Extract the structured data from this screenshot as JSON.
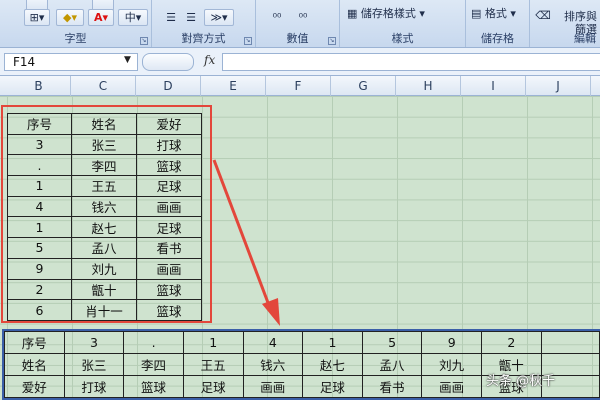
{
  "ribbon": {
    "groups": {
      "font": {
        "label": "字型"
      },
      "alignment": {
        "label": "對齊方式"
      },
      "number": {
        "label": "數值"
      },
      "styles": {
        "label": "樣式",
        "cell_styles_label": "儲存格樣式"
      },
      "cells": {
        "label": "儲存格",
        "format_label": "格式"
      },
      "editing": {
        "label": "編輯",
        "sort_filter_label": "排序與\n篩選"
      }
    }
  },
  "formula_bar": {
    "name_box": "F14",
    "fx_label": "fx",
    "formula": ""
  },
  "columns": [
    "B",
    "C",
    "D",
    "E",
    "F",
    "G",
    "H",
    "I",
    "J"
  ],
  "source_table": {
    "header": [
      "序号",
      "姓名",
      "爱好"
    ],
    "rows": [
      [
        "3",
        "张三",
        "打球"
      ],
      [
        ".",
        "李四",
        "篮球"
      ],
      [
        "1",
        "王五",
        "足球"
      ],
      [
        "4",
        "钱六",
        "画画"
      ],
      [
        "1",
        "赵七",
        "足球"
      ],
      [
        "5",
        "孟八",
        "看书"
      ],
      [
        "9",
        "刘九",
        "画画"
      ],
      [
        "2",
        "甑十",
        "篮球"
      ],
      [
        "6",
        "肖十一",
        "篮球"
      ]
    ]
  },
  "transposed_table": {
    "rows": [
      [
        "序号",
        "3",
        ".",
        "1",
        "4",
        "1",
        "5",
        "9",
        "2",
        ""
      ],
      [
        "姓名",
        "张三",
        "李四",
        "王五",
        "钱六",
        "赵七",
        "孟八",
        "刘九",
        "甑十",
        ""
      ],
      [
        "爱好",
        "打球",
        "篮球",
        "足球",
        "画画",
        "足球",
        "看书",
        "画画",
        "篮球",
        ""
      ]
    ]
  },
  "watermark": "头条 @秋千",
  "colors": {
    "red_highlight": "#e3473b",
    "blue_highlight": "#3b5fa8",
    "sheet_background": "#cfe3cf"
  }
}
